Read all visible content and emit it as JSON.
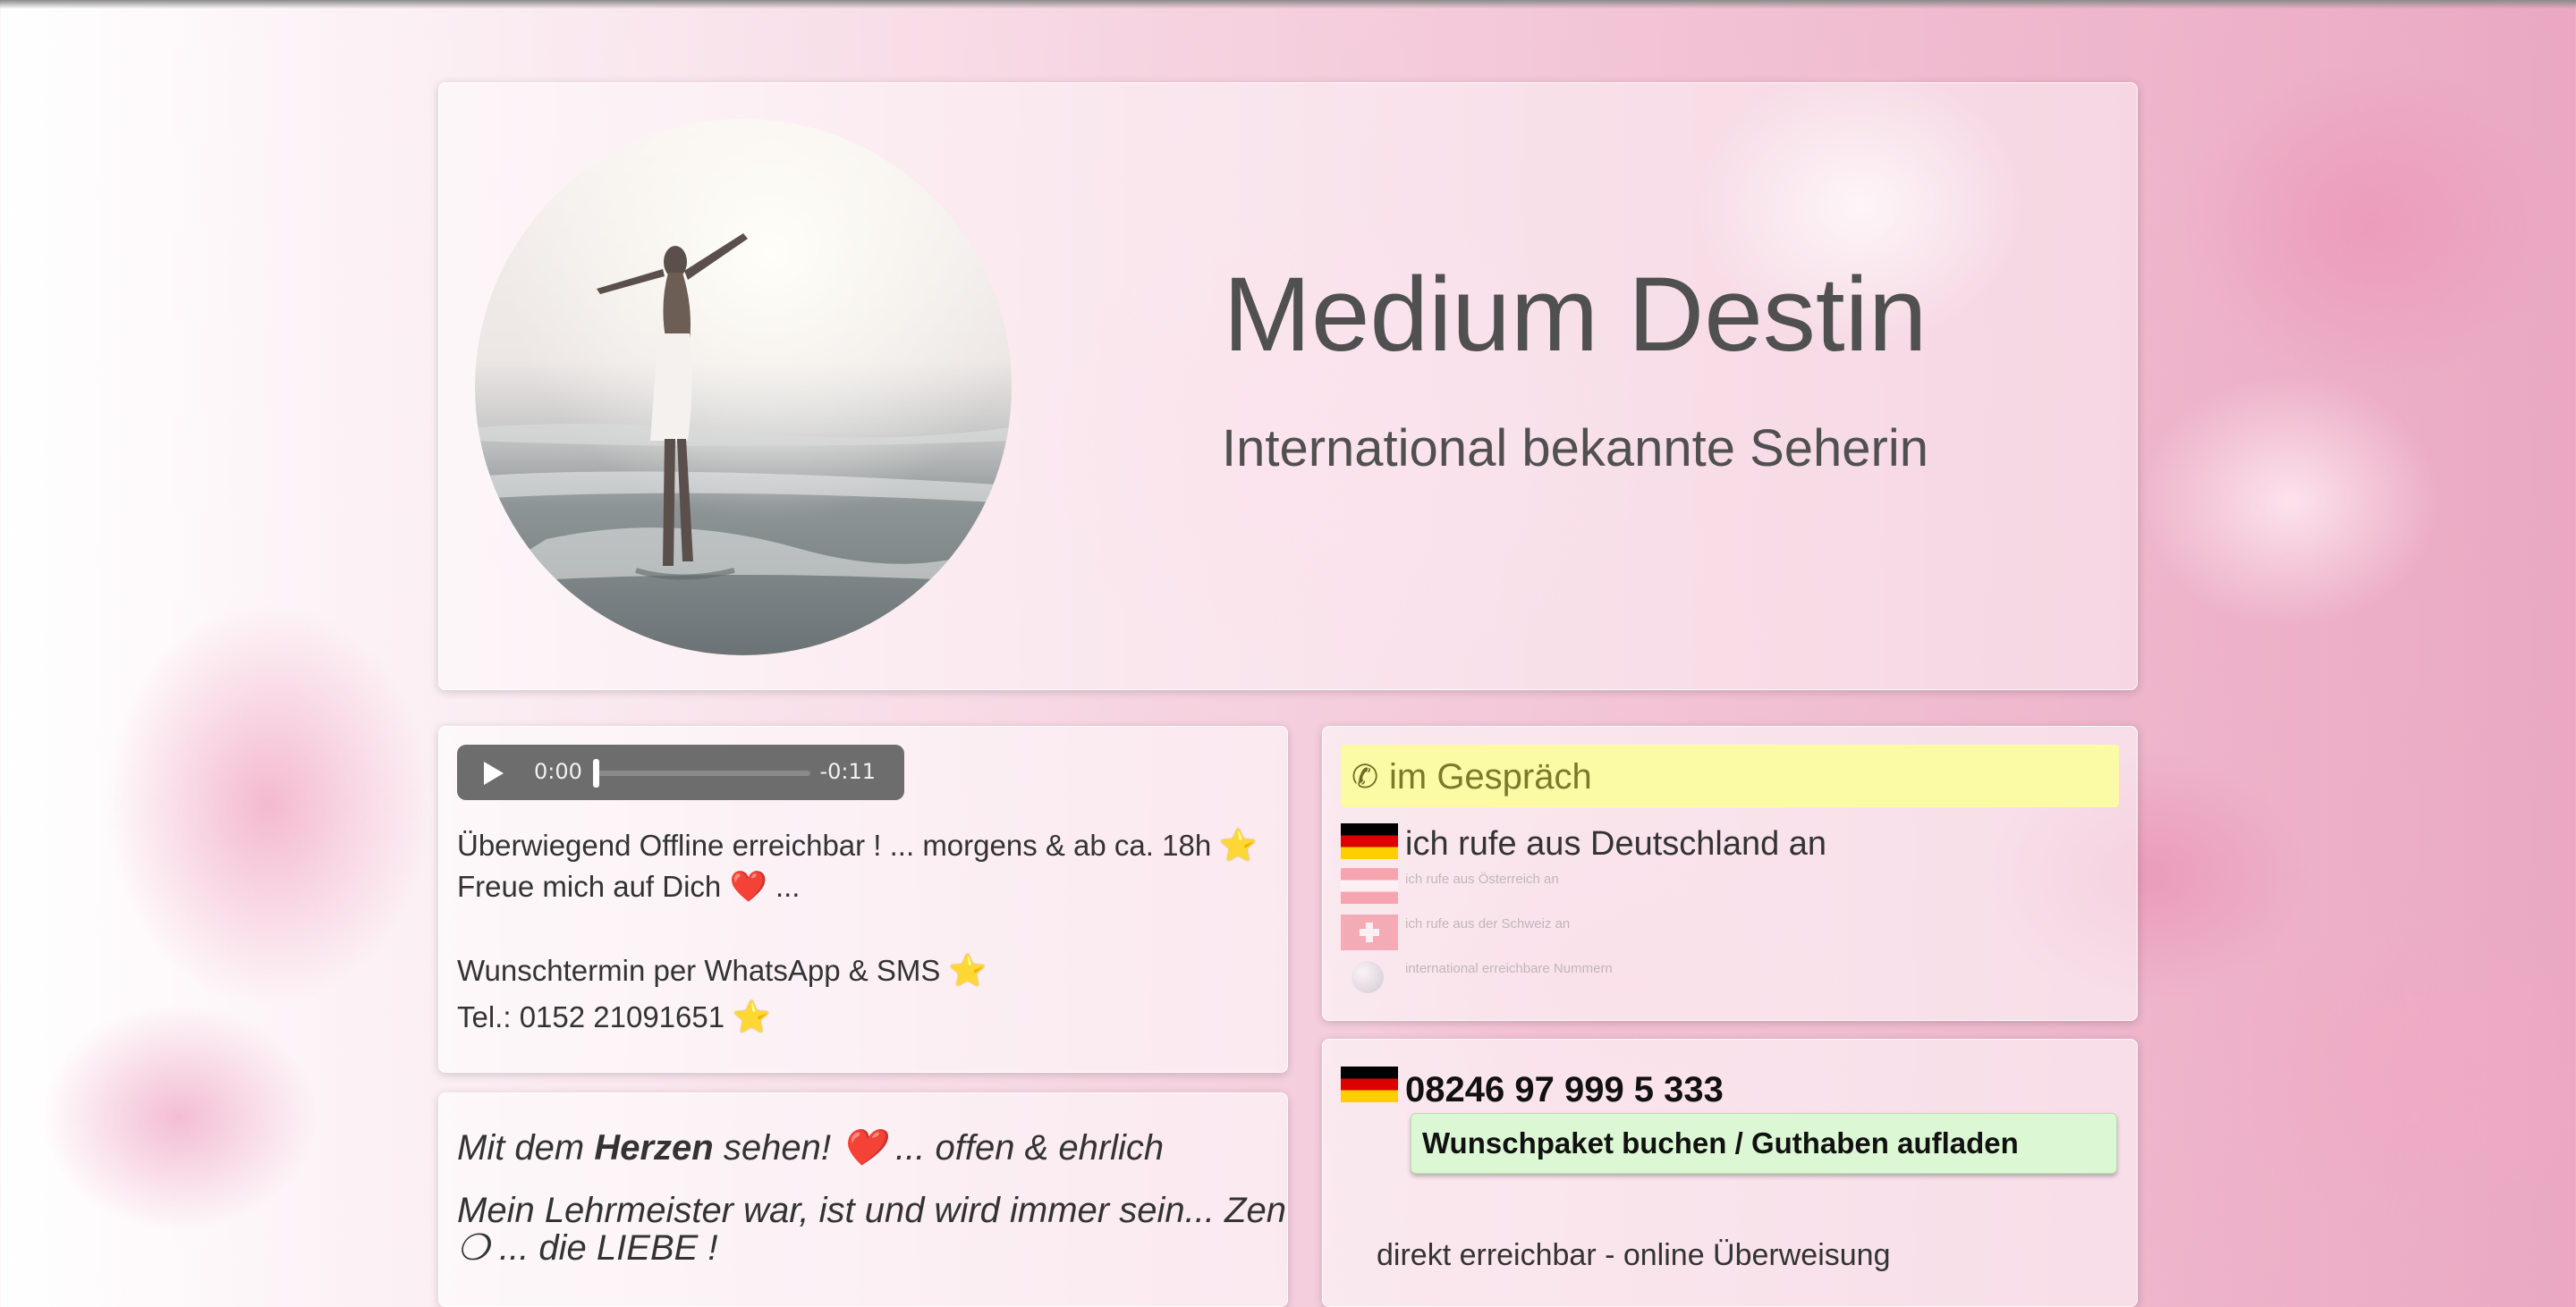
{
  "header": {
    "title": "Medium Destin",
    "subtitle": "International bekannte Seherin"
  },
  "audio": {
    "current_time": "0:00",
    "remaining_time": "-0:11",
    "progress": 0
  },
  "availability": {
    "line1": "Überwiegend Offline erreichbar ! ... morgens & ab ca. 18h",
    "line2_a": "Freue mich auf Dich",
    "line2_b": "...",
    "line3": "Wunschtermin per WhatsApp & SMS",
    "line4": "Tel.: 0152 21091651",
    "star": "⭐",
    "heart": "❤️"
  },
  "quote": {
    "line1_a": "Mit dem ",
    "line1_bold": "Herzen",
    "line1_b": " sehen!",
    "line1_c": " ... offen & ehrlich",
    "line2": "Mein Lehrmeister war, ist und wird immer sein... Zen",
    "line3": "❍ ... die LIEBE !",
    "heart": "❤️"
  },
  "status": {
    "label": "im Gespräch",
    "phone_glyph": "✆",
    "countries": [
      {
        "label": "ich rufe aus Deutschland an",
        "flag": "de",
        "active": true
      },
      {
        "label": "ich rufe aus Österreich an",
        "flag": "at",
        "active": false
      },
      {
        "label": "ich rufe aus der Schweiz an",
        "flag": "ch",
        "active": false
      },
      {
        "label": "international erreichbare Nummern",
        "flag": "globe",
        "active": false
      }
    ]
  },
  "booking": {
    "phone_number": "08246 97 999 5 333",
    "button_label": "Wunschpaket buchen / Guthaben aufladen",
    "note": "direkt erreichbar - online Überweisung"
  },
  "colors": {
    "status_bar": "#fbfba6",
    "book_button": "#dcf7d3",
    "heart": "#e0102a",
    "star": "#f3c317"
  }
}
